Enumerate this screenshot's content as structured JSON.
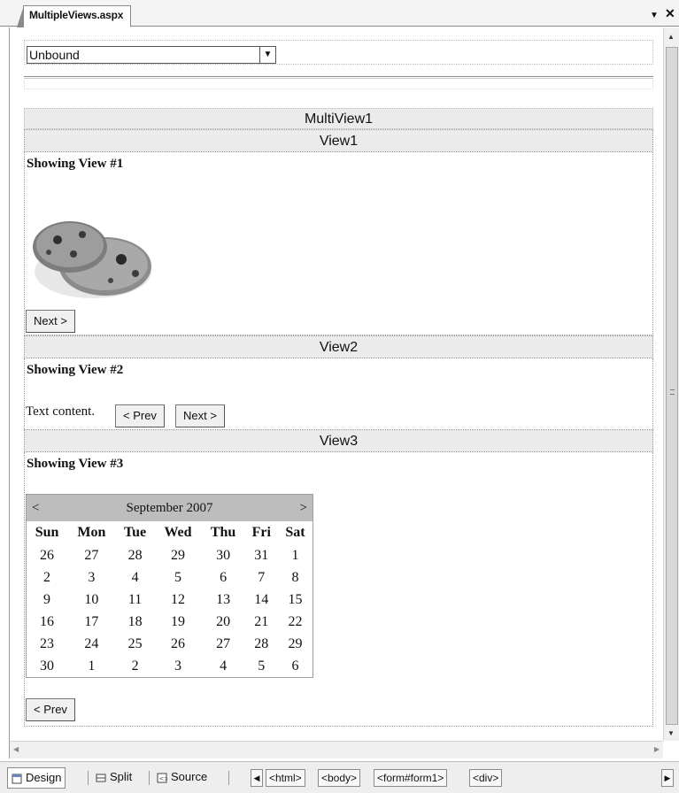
{
  "tab": {
    "title": "MultipleViews.aspx",
    "dropdown_icon": "chevron-down-icon",
    "close_icon": "close-icon"
  },
  "form": {
    "dropdown_value": "Unbound"
  },
  "multiview": {
    "title": "MultiView1",
    "views": [
      {
        "name": "View1",
        "heading": "Showing View #1",
        "next_label": "Next >",
        "image": "cookies-image"
      },
      {
        "name": "View2",
        "heading": "Showing View #2",
        "text": "Text content.",
        "prev_label": "< Prev",
        "next_label": "Next >"
      },
      {
        "name": "View3",
        "heading": "Showing View #3",
        "prev_label": "< Prev"
      }
    ]
  },
  "calendar": {
    "prev": "<",
    "next": ">",
    "month": "September 2007",
    "days": [
      "Sun",
      "Mon",
      "Tue",
      "Wed",
      "Thu",
      "Fri",
      "Sat"
    ],
    "weeks": [
      [
        "26",
        "27",
        "28",
        "29",
        "30",
        "31",
        "1"
      ],
      [
        "2",
        "3",
        "4",
        "5",
        "6",
        "7",
        "8"
      ],
      [
        "9",
        "10",
        "11",
        "12",
        "13",
        "14",
        "15"
      ],
      [
        "16",
        "17",
        "18",
        "19",
        "20",
        "21",
        "22"
      ],
      [
        "23",
        "24",
        "25",
        "26",
        "27",
        "28",
        "29"
      ],
      [
        "30",
        "1",
        "2",
        "3",
        "4",
        "5",
        "6"
      ]
    ]
  },
  "bottom": {
    "design": "Design",
    "split": "Split",
    "source": "Source",
    "crumbs": [
      "<html>",
      "<body>",
      "<form#form1>",
      "<div>"
    ]
  }
}
